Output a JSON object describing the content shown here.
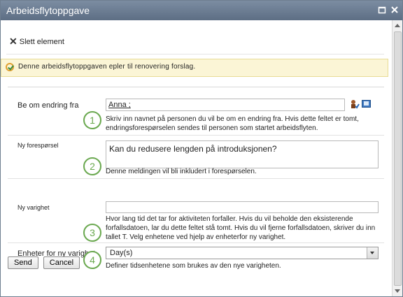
{
  "window": {
    "title": "Arbeidsflytoppgave"
  },
  "toolbar": {
    "delete_label": "Slett element"
  },
  "info": {
    "message": "Denne arbeidsflytoppgaven epler til renovering forslag."
  },
  "fields": [
    {
      "number": "1",
      "label": "Be om endring fra",
      "value": "Anna ;",
      "description": "Skriv inn navnet på personen du vil be om en endring fra. Hvis dette feltet er tomt, endringsforespørselen sendes til personen som startet arbeidsflyten."
    },
    {
      "number": "2",
      "label": "Ny forespørsel",
      "value": "Kan du redusere lengden på introduksjonen?",
      "description": "Denne meldingen vil bli inkludert i forespørselen."
    },
    {
      "number": "3",
      "label": "Ny varighet",
      "value": "",
      "description": "Hvor lang tid det tar for aktiviteten forfaller. Hvis du vil beholde den eksisterende forfallsdatoen, lar du dette feltet stå tomt. Hvis du vil fjerne forfallsdatoen, skriver du inn tallet T. Velg enhetene ved hjelp av enheterfor ny varighet."
    },
    {
      "number": "4",
      "label": "Enheter for ny varighet",
      "value": "Day(s)",
      "description": "Definer tidsenhetene som brukes av den nye varigheten."
    }
  ],
  "buttons": {
    "send": "Send",
    "cancel": "Cancel"
  }
}
